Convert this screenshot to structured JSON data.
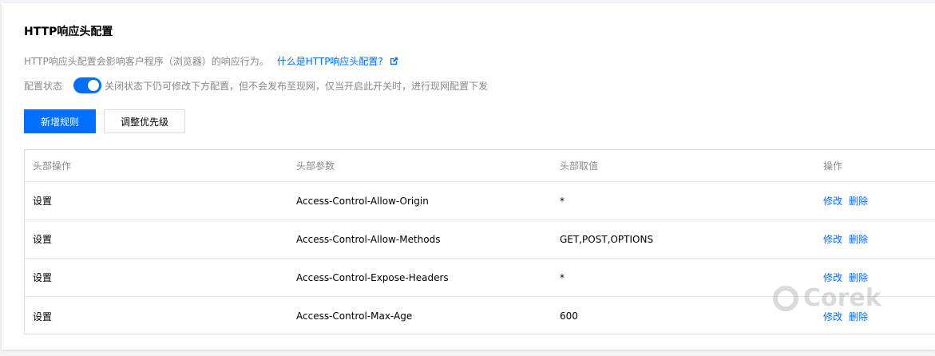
{
  "page": {
    "title": "HTTP响应头配置",
    "description": "HTTP响应头配置会影响客户程序（浏览器）的响应行为。",
    "help_link": "什么是HTTP响应头配置?",
    "status_label": "配置状态",
    "status_on": true,
    "status_hint": "关闭状态下仍可修改下方配置，但不会发布至现网，仅当开启此开关时，进行现网配置下发"
  },
  "toolbar": {
    "add_rule": "新增规则",
    "adjust_priority": "调整优先级"
  },
  "table": {
    "columns": [
      "头部操作",
      "头部参数",
      "头部取值",
      "操作"
    ],
    "rows": [
      {
        "op": "设置",
        "param": "Access-Control-Allow-Origin",
        "value": "*",
        "edit": "修改",
        "delete": "删除"
      },
      {
        "op": "设置",
        "param": "Access-Control-Allow-Methods",
        "value": "GET,POST,OPTIONS",
        "edit": "修改",
        "delete": "删除"
      },
      {
        "op": "设置",
        "param": "Access-Control-Expose-Headers",
        "value": "*",
        "edit": "修改",
        "delete": "删除"
      },
      {
        "op": "设置",
        "param": "Access-Control-Max-Age",
        "value": "600",
        "edit": "修改",
        "delete": "删除"
      }
    ]
  },
  "watermark": "Corek",
  "colors": {
    "accent": "#006eff",
    "muted": "#888888",
    "border": "#dcdcdc"
  }
}
